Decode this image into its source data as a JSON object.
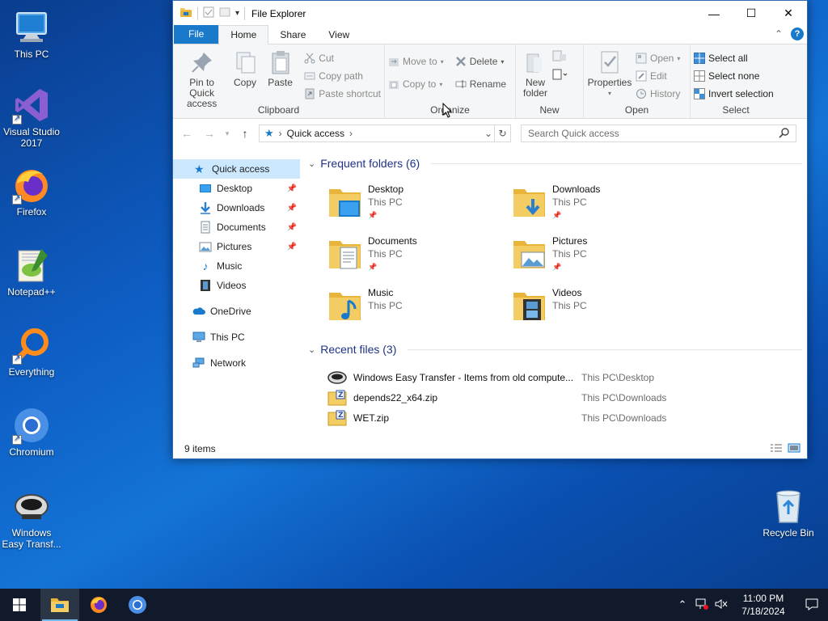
{
  "desktop": {
    "icons": [
      {
        "label": "This PC"
      },
      {
        "label": "Visual Studio 2017"
      },
      {
        "label": "Firefox"
      },
      {
        "label": "Notepad++"
      },
      {
        "label": "Everything"
      },
      {
        "label": "Chromium"
      },
      {
        "label": "Windows Easy Transf..."
      },
      {
        "label": "Recycle Bin"
      }
    ]
  },
  "window": {
    "title": "File Explorer",
    "tabs": [
      "File",
      "Home",
      "Share",
      "View"
    ],
    "ribbon": {
      "clipboard": {
        "label": "Clipboard",
        "pin": "Pin to Quick access",
        "copy": "Copy",
        "paste": "Paste",
        "cut": "Cut",
        "copy_path": "Copy path",
        "paste_shortcut": "Paste shortcut"
      },
      "organize": {
        "label": "Organize",
        "move_to": "Move to",
        "copy_to": "Copy to",
        "delete": "Delete",
        "rename": "Rename"
      },
      "new": {
        "label": "New",
        "new_folder": "New folder"
      },
      "open": {
        "label": "Open",
        "properties": "Properties",
        "open": "Open",
        "edit": "Edit",
        "history": "History"
      },
      "select": {
        "label": "Select",
        "select_all": "Select all",
        "select_none": "Select none",
        "invert": "Invert selection"
      }
    },
    "address": {
      "path": "Quick access"
    },
    "search": {
      "placeholder": "Search Quick access"
    },
    "nav": [
      {
        "label": "Quick access"
      },
      {
        "label": "Desktop"
      },
      {
        "label": "Downloads"
      },
      {
        "label": "Documents"
      },
      {
        "label": "Pictures"
      },
      {
        "label": "Music"
      },
      {
        "label": "Videos"
      },
      {
        "label": "OneDrive"
      },
      {
        "label": "This PC"
      },
      {
        "label": "Network"
      }
    ],
    "frequent": {
      "heading": "Frequent folders (6)",
      "items": [
        {
          "name": "Desktop",
          "loc": "This PC"
        },
        {
          "name": "Downloads",
          "loc": "This PC"
        },
        {
          "name": "Documents",
          "loc": "This PC"
        },
        {
          "name": "Pictures",
          "loc": "This PC"
        },
        {
          "name": "Music",
          "loc": "This PC"
        },
        {
          "name": "Videos",
          "loc": "This PC"
        }
      ]
    },
    "recent": {
      "heading": "Recent files (3)",
      "items": [
        {
          "name": "Windows Easy Transfer - Items from old compute...",
          "path": "This PC\\Desktop"
        },
        {
          "name": "depends22_x64.zip",
          "path": "This PC\\Downloads"
        },
        {
          "name": "WET.zip",
          "path": "This PC\\Downloads"
        }
      ]
    },
    "status": {
      "count": "9 items"
    }
  },
  "taskbar": {
    "time": "11:00 PM",
    "date": "7/18/2024"
  },
  "colors": {
    "accent": "#1979ca",
    "selection": "#cce8ff",
    "folder": "#f0c552",
    "taskbar": "#101a2a"
  }
}
